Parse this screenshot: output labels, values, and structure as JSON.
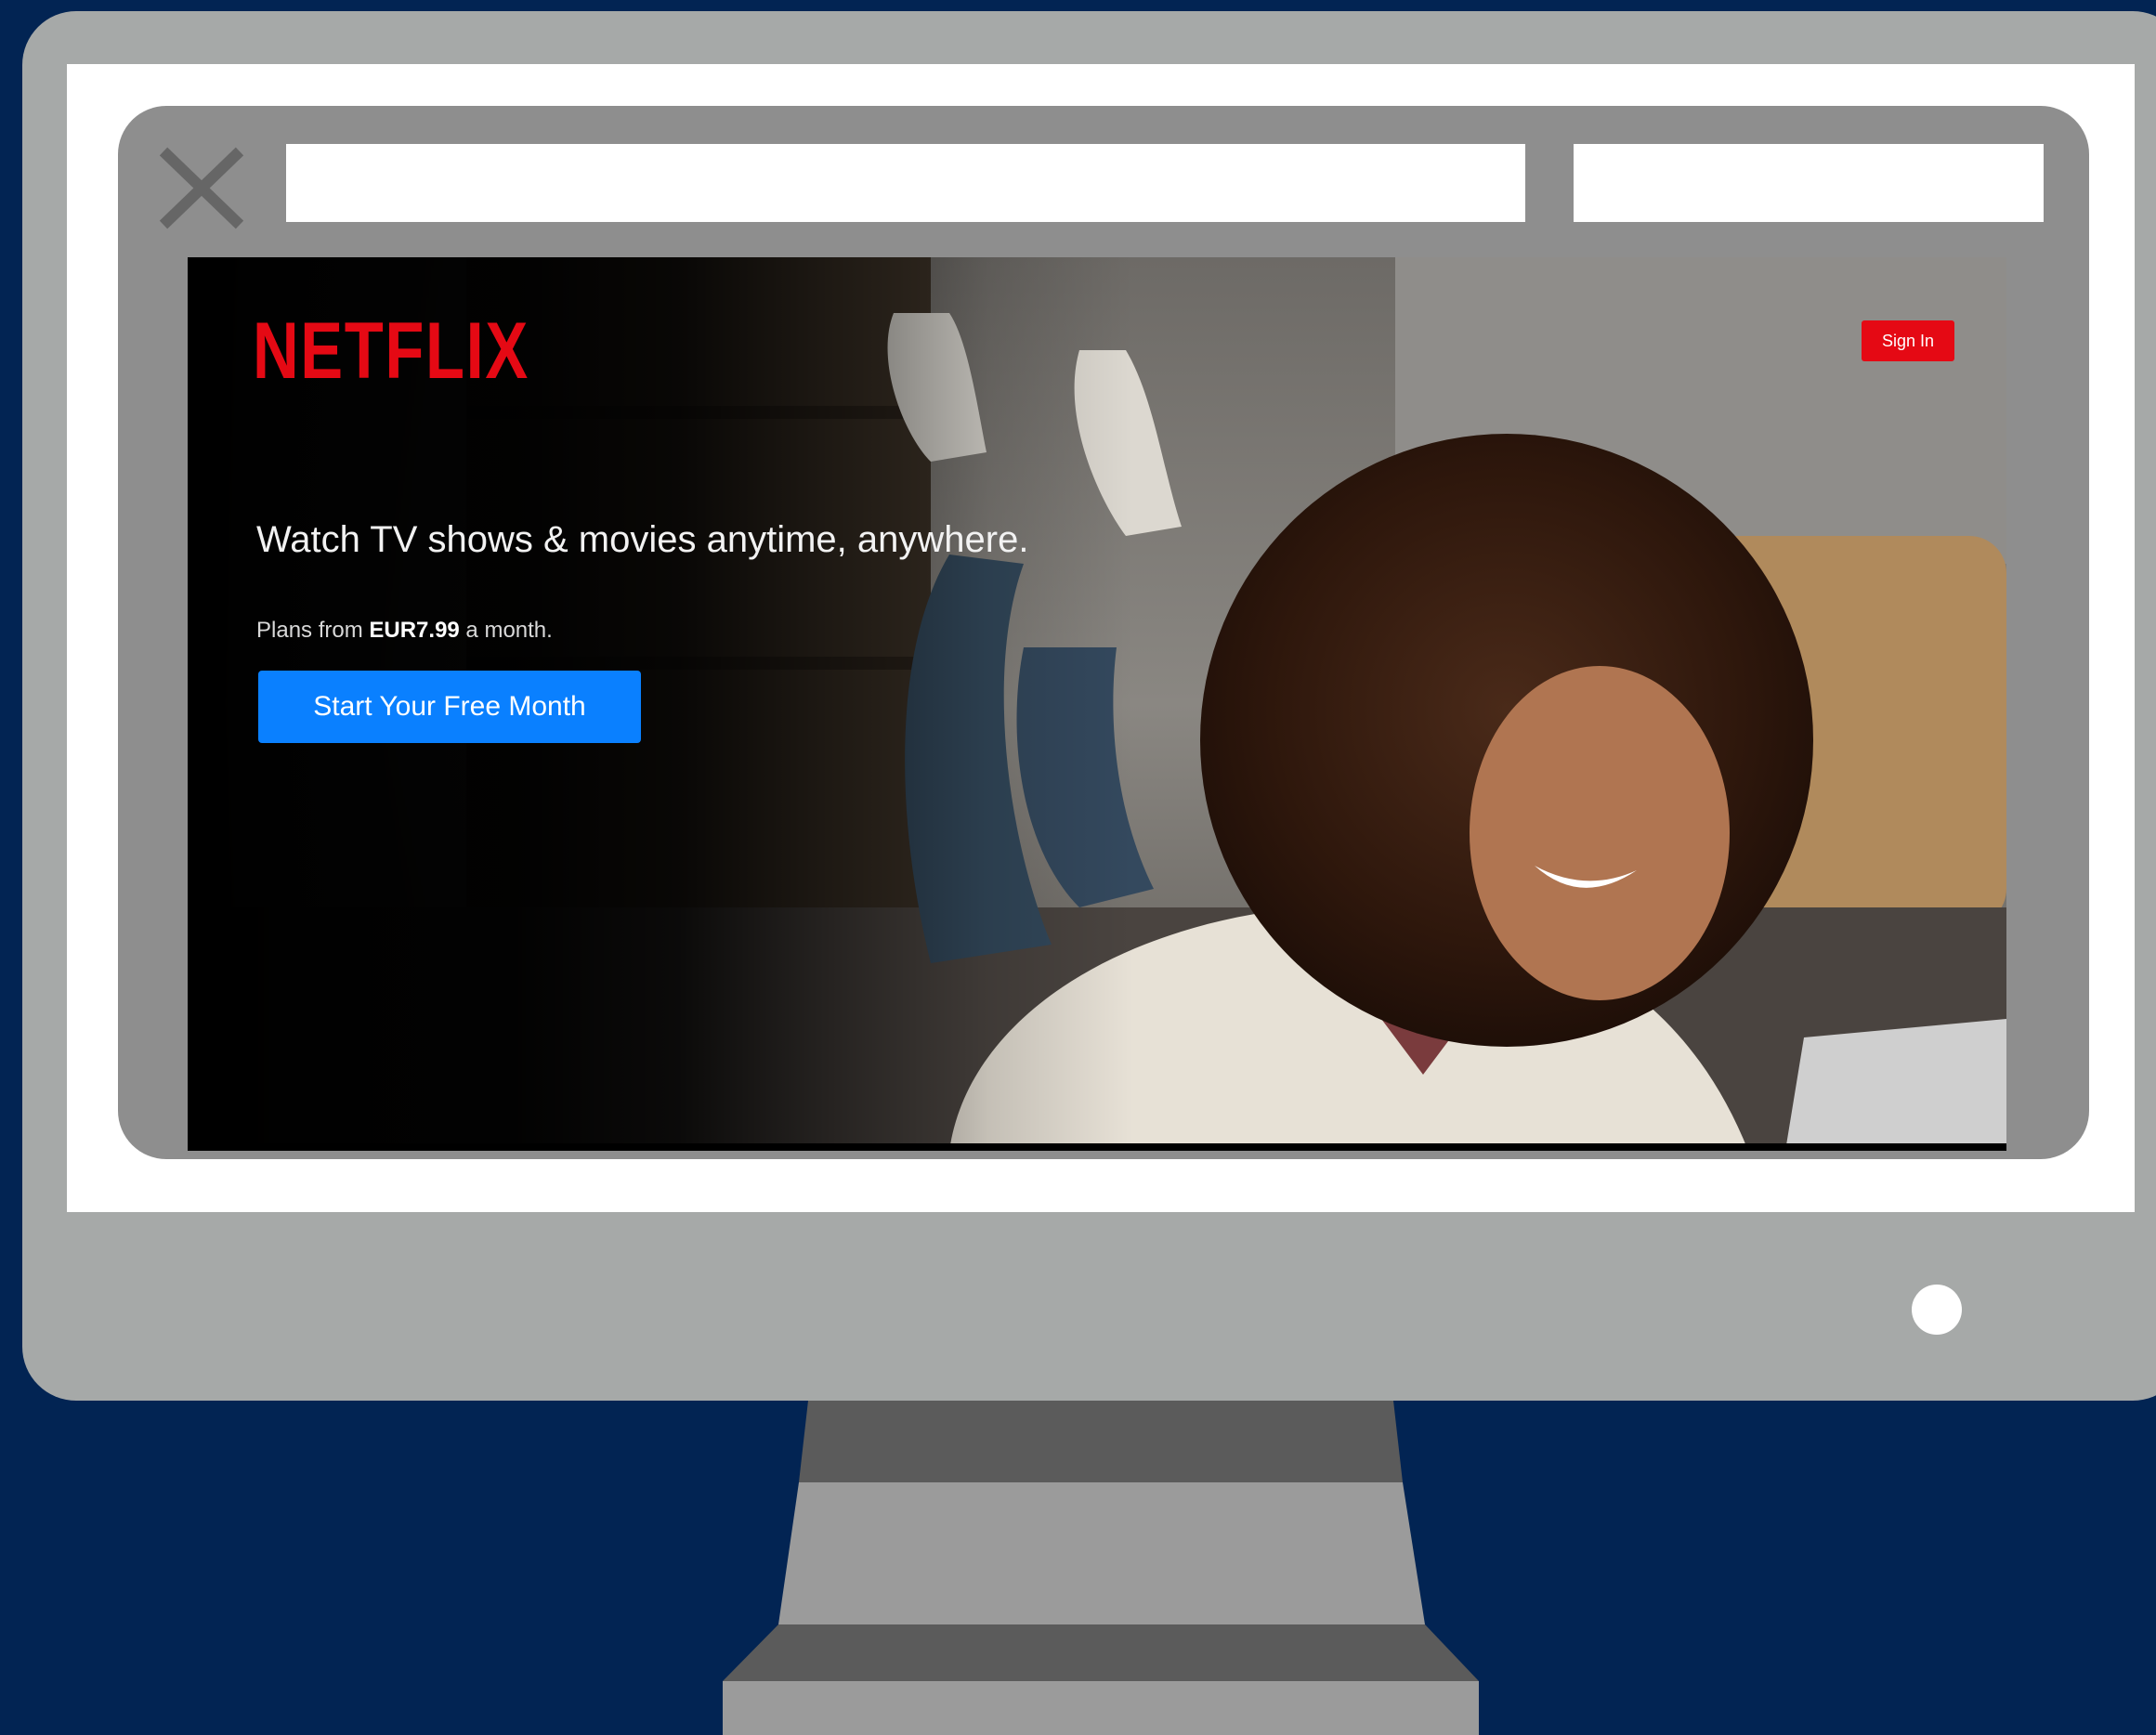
{
  "browser": {
    "address_value": "",
    "search_value": ""
  },
  "netflix": {
    "logo_text": "NETFLIX",
    "sign_in_label": "Sign In",
    "headline": "Watch TV shows & movies anytime, anywhere.",
    "plans_prefix": "Plans from ",
    "plans_price": "EUR7.99",
    "plans_suffix": " a month.",
    "cta_label": "Start Your Free Month"
  },
  "colors": {
    "background": "#022453",
    "monitor_gray": "#a6a9a8",
    "browser_frame": "#8e8e8e",
    "netflix_red": "#e50914",
    "cta_blue": "#0a80ff"
  },
  "icons": [
    "close-icon"
  ]
}
